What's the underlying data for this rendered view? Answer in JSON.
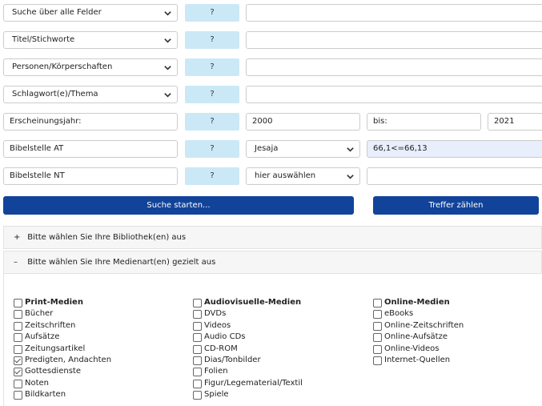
{
  "search_rows": [
    {
      "field": "Suche über alle Felder",
      "help": "?",
      "value": ""
    },
    {
      "field": "Titel/Stichworte",
      "help": "?",
      "value": ""
    },
    {
      "field": "Personen/Körperschaften",
      "help": "?",
      "value": ""
    },
    {
      "field": "Schlagwort(e)/Thema",
      "help": "?",
      "value": ""
    }
  ],
  "year_row": {
    "label": "Erscheinungsjahr:",
    "help": "?",
    "from": "2000",
    "to_label": "bis:",
    "to": "2021"
  },
  "bible_at": {
    "label": "Bibelstelle AT",
    "help": "?",
    "book": "Jesaja",
    "range": "66,1<=66,13"
  },
  "bible_nt": {
    "label": "Bibelstelle NT",
    "help": "?",
    "book": "hier auswählen",
    "range": ""
  },
  "buttons": {
    "search": "Suche starten...",
    "count": "Treffer zählen"
  },
  "panels": {
    "library": {
      "sign": "+",
      "label": "Bitte wählen Sie Ihre Bibliothek(en) aus"
    },
    "media": {
      "sign": "–",
      "label": "Bitte wählen Sie Ihre Medienart(en) gezielt aus"
    }
  },
  "media_columns": [
    {
      "header": "Print-Medien",
      "header_checked": false,
      "items": [
        {
          "label": "Bücher",
          "checked": false
        },
        {
          "label": "Zeitschriften",
          "checked": false
        },
        {
          "label": "Aufsätze",
          "checked": false
        },
        {
          "label": "Zeitungsartikel",
          "checked": false
        },
        {
          "label": "Predigten, Andachten",
          "checked": true
        },
        {
          "label": "Gottesdienste",
          "checked": true
        },
        {
          "label": "Noten",
          "checked": false
        },
        {
          "label": "Bildkarten",
          "checked": false
        }
      ]
    },
    {
      "header": "Audiovisuelle-Medien",
      "header_checked": false,
      "items": [
        {
          "label": "DVDs",
          "checked": false
        },
        {
          "label": "Videos",
          "checked": false
        },
        {
          "label": "Audio CDs",
          "checked": false
        },
        {
          "label": "CD-ROM",
          "checked": false
        },
        {
          "label": "Dias/Tonbilder",
          "checked": false
        },
        {
          "label": "Folien",
          "checked": false
        },
        {
          "label": "Figur/Legematerial/Textil",
          "checked": false
        },
        {
          "label": "Spiele",
          "checked": false
        }
      ]
    },
    {
      "header": "Online-Medien",
      "header_checked": false,
      "items": [
        {
          "label": "eBooks",
          "checked": false
        },
        {
          "label": "Online-Zeitschriften",
          "checked": false
        },
        {
          "label": "Online-Aufsätze",
          "checked": false
        },
        {
          "label": "Online-Videos",
          "checked": false
        },
        {
          "label": "Internet-Quellen",
          "checked": false
        }
      ]
    }
  ]
}
